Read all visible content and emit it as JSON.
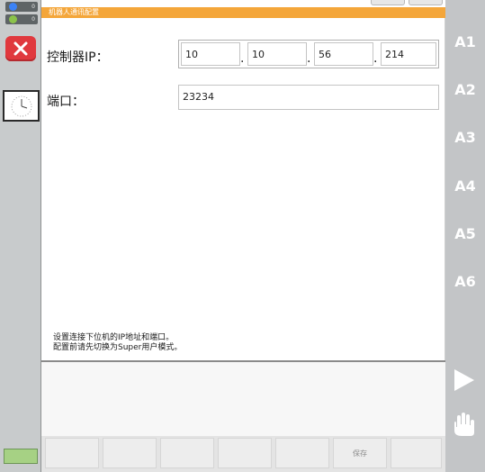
{
  "window": {
    "title": "机器人通讯配置"
  },
  "left_sidebar": {
    "status_items": [
      {
        "icon": "info-icon",
        "count": "0",
        "color": "#3b82f6"
      },
      {
        "icon": "warning-icon",
        "count": "0",
        "color": "#8bc34a"
      }
    ],
    "close_icon": "close-icon",
    "clock_icon": "clock-icon"
  },
  "form": {
    "ip_label": "控制器IP：",
    "ip_octets": [
      "10",
      "10",
      "56",
      "214"
    ],
    "ip_separator": ".",
    "port_label": "端口：",
    "port_value": "23234",
    "hint_line1": "设置连接下位机的IP地址和端口。",
    "hint_line2": "配置前请先切换为Super用户模式。"
  },
  "bottom_bar": {
    "buttons": [
      "",
      "",
      "",
      "",
      "",
      "保存",
      ""
    ]
  },
  "right_sidebar": {
    "axes": [
      "A1",
      "A2",
      "A3",
      "A4",
      "A5",
      "A6"
    ],
    "play_icon": "play-icon",
    "hand_icon": "hand-icon"
  },
  "colors": {
    "accent_orange": "#f4a63a",
    "close_red": "#e0393e",
    "sidebar_gray": "#c3c5c7"
  }
}
